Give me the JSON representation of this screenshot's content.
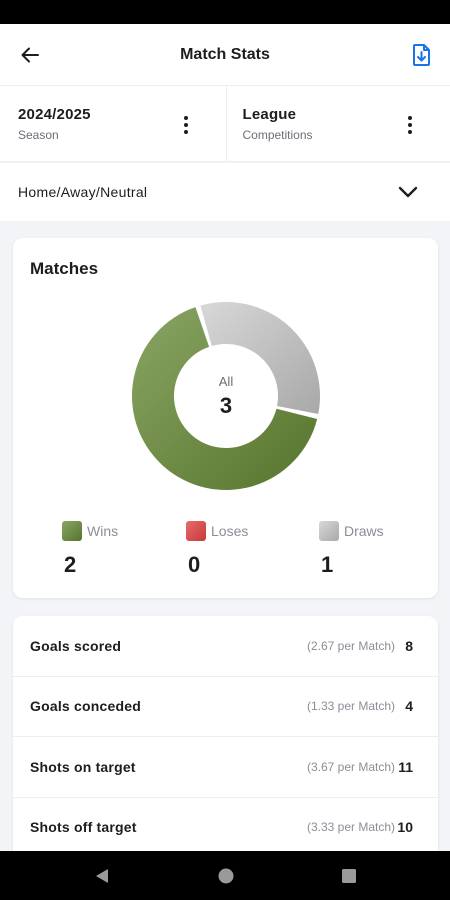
{
  "header": {
    "title": "Match Stats",
    "back_icon": "arrow-left-icon",
    "export_icon": "file-download-icon"
  },
  "filters": {
    "season": {
      "value": "2024/2025",
      "label": "Season"
    },
    "competition": {
      "value": "League",
      "label": "Competitions"
    },
    "venue": "Home/Away/Neutral"
  },
  "matches": {
    "heading": "Matches",
    "center_label": "All",
    "total": "3",
    "legend": [
      {
        "name": "Wins",
        "count": "2",
        "color": "#6b8a3e"
      },
      {
        "name": "Loses",
        "count": "0",
        "color": "#d94a4a"
      },
      {
        "name": "Draws",
        "count": "1",
        "color": "#bdbdbd"
      }
    ]
  },
  "chart_data": {
    "type": "pie",
    "categories": [
      "Wins",
      "Loses",
      "Draws"
    ],
    "values": [
      2,
      0,
      1
    ],
    "title": "Matches",
    "center_label": "All",
    "center_value": 3,
    "colors": [
      "#6b8a3e",
      "#d94a4a",
      "#bdbdbd"
    ]
  },
  "stats": [
    {
      "label": "Goals scored",
      "per_match": "(2.67 per Match)",
      "value": "8"
    },
    {
      "label": "Goals conceded",
      "per_match": "(1.33 per Match)",
      "value": "4"
    },
    {
      "label": "Shots on target",
      "per_match": "(3.67 per Match)",
      "value": "11"
    },
    {
      "label": "Shots off target",
      "per_match": "(3.33 per Match)",
      "value": "10"
    }
  ],
  "colors": {
    "accent": "#1a73e8",
    "win": "#6b8a3e",
    "lose": "#d94a4a",
    "draw": "#bdbdbd"
  }
}
